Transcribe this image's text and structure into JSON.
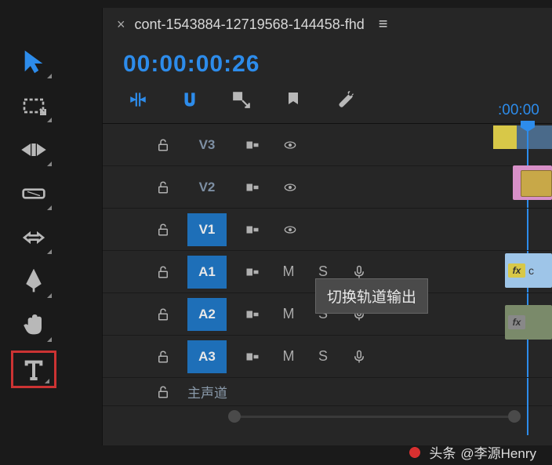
{
  "toolbar": {
    "tools": [
      {
        "name": "selection",
        "active": true
      },
      {
        "name": "track-select"
      },
      {
        "name": "ripple-edit"
      },
      {
        "name": "razor"
      },
      {
        "name": "slip"
      },
      {
        "name": "pen"
      },
      {
        "name": "hand"
      },
      {
        "name": "type",
        "highlighted": true
      }
    ]
  },
  "panel": {
    "close": "×",
    "sequence_name": "cont-1543884-12719568-144458-fhd",
    "menu": "≡",
    "timecode": "00:00:00:26",
    "ruler_time": ":00:00"
  },
  "tracks": {
    "video": [
      {
        "label": "V3",
        "active": false
      },
      {
        "label": "V2",
        "active": false
      },
      {
        "label": "V1",
        "active": true
      }
    ],
    "audio": [
      {
        "label": "A1",
        "m": "M",
        "s": "S"
      },
      {
        "label": "A2",
        "m": "M",
        "s": "S"
      },
      {
        "label": "A3",
        "m": "M",
        "s": "S"
      }
    ],
    "master_label": "主声道"
  },
  "tooltip": "切换轨道输出",
  "clips": {
    "v1_text": "c",
    "fx": "fx"
  },
  "attribution": {
    "prefix": "头条",
    "handle": "@李源Henry"
  }
}
